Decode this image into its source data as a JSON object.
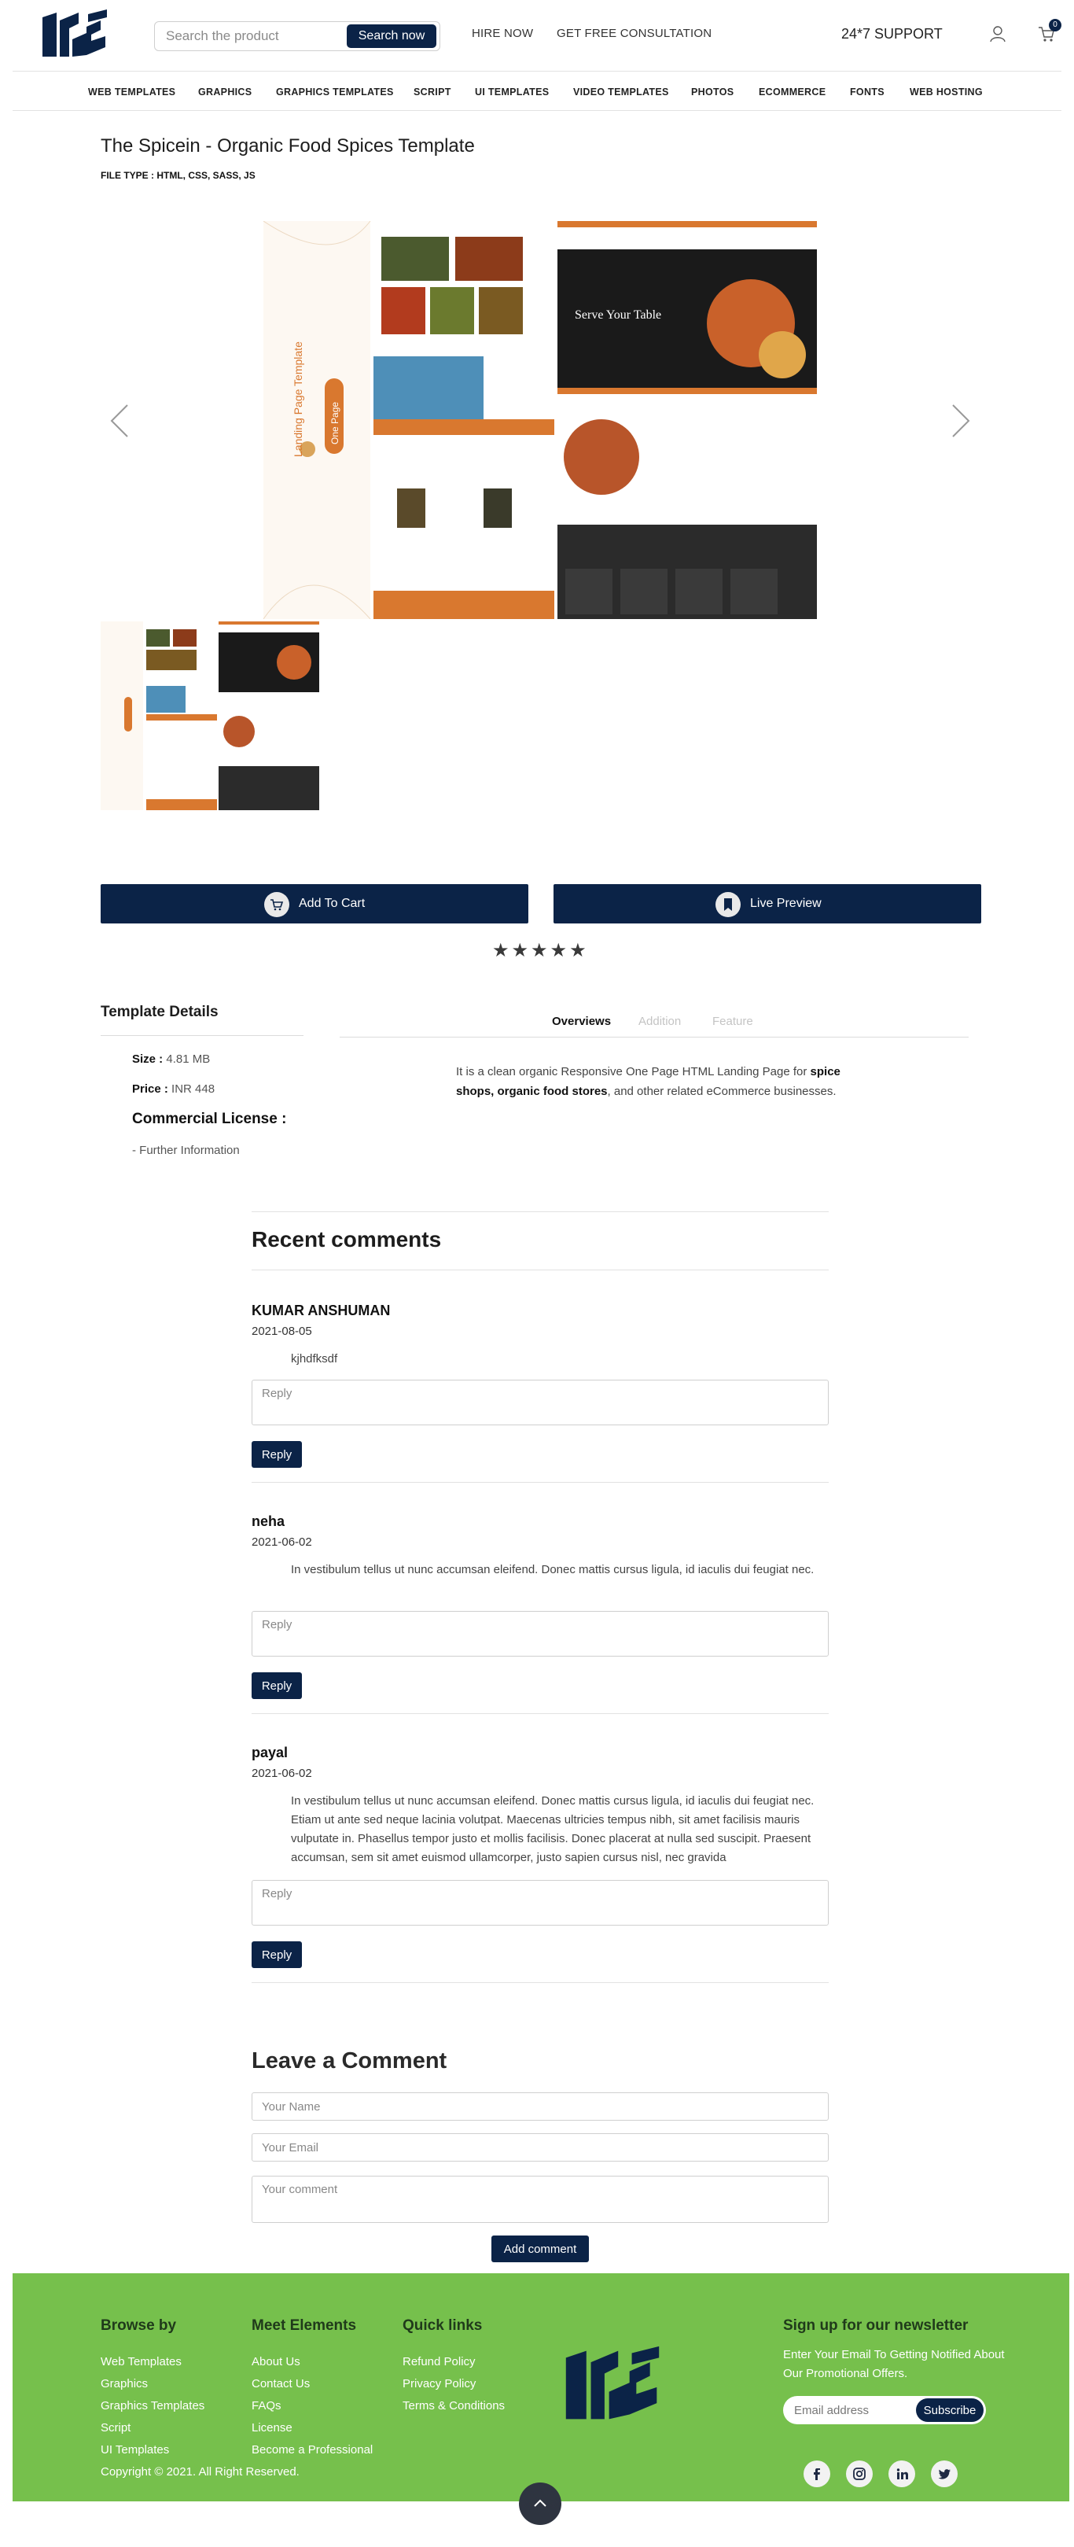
{
  "header": {
    "search_placeholder": "Search the product",
    "search_button": "Search now",
    "hire_now": "HIRE NOW",
    "consultation": "GET FREE CONSULTATION",
    "support": "24*7 SUPPORT",
    "cart_count": "0"
  },
  "categories": [
    "WEB TEMPLATES",
    "GRAPHICS",
    "GRAPHICS TEMPLATES",
    "SCRIPT",
    "UI TEMPLATES",
    "VIDEO TEMPLATES",
    "PHOTOS",
    "ECOMMERCE",
    "FONTS",
    "WEB HOSTING"
  ],
  "product": {
    "title": "The Spicein - Organic Food Spices Template",
    "file_type": "FILE TYPE : HTML, CSS, SASS, JS",
    "preview_banner": "Landing Page Template",
    "preview_badge": "One Page",
    "preview_hero": "Serve Your Table",
    "add_to_cart": "Add To Cart",
    "live_preview": "Live Preview",
    "rating": 5
  },
  "details": {
    "title": "Template Details",
    "size_label": "Size :",
    "size_value": "4.81 MB",
    "price_label": "Price :",
    "price_value": "INR 448",
    "license_title": "Commercial License :",
    "further": "- Further Information",
    "tabs": [
      "Overviews",
      "Addition",
      "Feature"
    ],
    "desc_a": "It is a clean organic Responsive One Page HTML Landing Page for ",
    "desc_b": "spice shops, organic food stores",
    "desc_c": ", and other related eCommerce businesses."
  },
  "comments": {
    "title": "Recent comments",
    "reply_placeholder": "Reply",
    "reply_button": "Reply",
    "items": [
      {
        "author": "KUMAR ANSHUMAN",
        "date": "2021-08-05",
        "text": "kjhdfksdf"
      },
      {
        "author": "neha",
        "date": "2021-06-02",
        "text": "In vestibulum tellus ut nunc accumsan eleifend. Donec mattis cursus ligula, id iaculis dui feugiat nec."
      },
      {
        "author": "payal",
        "date": "2021-06-02",
        "text": "In vestibulum tellus ut nunc accumsan eleifend. Donec mattis cursus ligula, id iaculis dui feugiat nec. Etiam ut ante sed neque lacinia volutpat. Maecenas ultricies tempus nibh, sit amet facilisis mauris vulputate in. Phasellus tempor justo et mollis facilisis. Donec placerat at nulla sed suscipit. Praesent accumsan, sem sit amet euismod ullamcorper, justo sapien cursus nisl, nec gravida"
      }
    ]
  },
  "leave_comment": {
    "title": "Leave a Comment",
    "name_placeholder": "Your Name",
    "email_placeholder": "Your Email",
    "comment_placeholder": "Your comment",
    "button": "Add comment"
  },
  "footer": {
    "browse_title": "Browse by",
    "browse": [
      "Web Templates",
      "Graphics",
      "Graphics Templates",
      "Script",
      "UI Templates"
    ],
    "meet_title": "Meet Elements",
    "meet": [
      "About Us",
      "Contact Us",
      "FAQs",
      "License",
      "Become a Professional"
    ],
    "quick_title": "Quick links",
    "quick": [
      "Refund Policy",
      "Privacy Policy",
      "Terms & Conditions"
    ],
    "newsletter_title": "Sign up for our newsletter",
    "newsletter_text": "Enter Your Email To Getting Notified About Our Promotional Offers.",
    "email_placeholder": "Email address",
    "subscribe": "Subscribe",
    "copyright": "Copyright © 2021. All Right Reserved.",
    "social": [
      "f",
      "ig",
      "in",
      "tw"
    ]
  },
  "colors": {
    "navy": "#0b2347",
    "footer_green": "#76c04c",
    "accent_orange": "#d9782f"
  }
}
